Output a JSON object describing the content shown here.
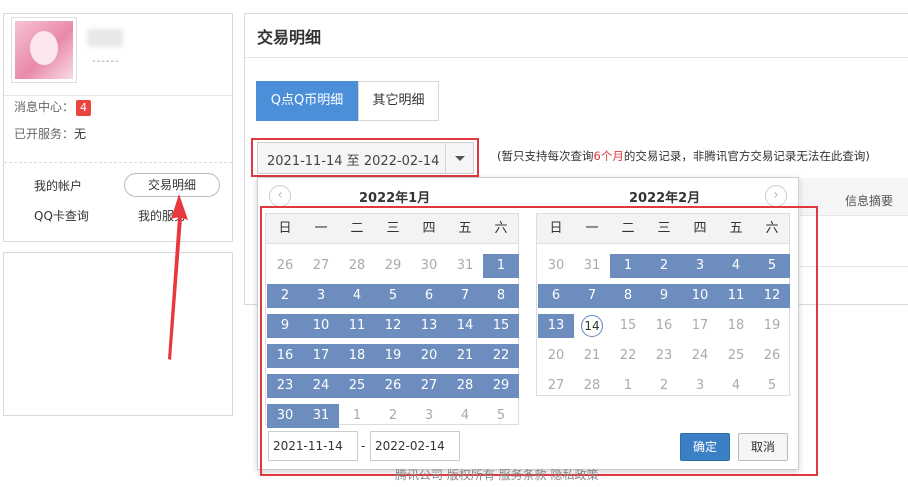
{
  "sidebar": {
    "message_center_label": "消息中心：",
    "message_count": "4",
    "services_label": "已开服务：",
    "services_value": "无",
    "username_placeholder": "------",
    "links": {
      "my_account": "我的帐户",
      "transactions": "交易明细",
      "qq_card": "QQ卡查询",
      "my_services": "我的服务"
    }
  },
  "main": {
    "title": "交易明细",
    "tabs": [
      {
        "label": "Q点Q币明细",
        "active": true
      },
      {
        "label": "其它明细",
        "active": false
      }
    ],
    "date_range": "2021-11-14 至 2022-02-14",
    "note_prefix": "(暂只支持每次查询",
    "note_highlight": "6个月",
    "note_suffix": "的交易记录，非腾讯官方交易记录无法在此查询)",
    "column_summary": "信息摘要"
  },
  "picker": {
    "prev_icon": "‹",
    "next_icon": "›",
    "weekdays": [
      "日",
      "一",
      "二",
      "三",
      "四",
      "五",
      "六"
    ],
    "months": [
      {
        "title": "2022年1月",
        "weeks": [
          [
            {
              "d": "26",
              "s": "off"
            },
            {
              "d": "27",
              "s": "off"
            },
            {
              "d": "28",
              "s": "off"
            },
            {
              "d": "29",
              "s": "off"
            },
            {
              "d": "30",
              "s": "off"
            },
            {
              "d": "31",
              "s": "off"
            },
            {
              "d": "1",
              "s": "sel"
            }
          ],
          [
            {
              "d": "2",
              "s": "sel"
            },
            {
              "d": "3",
              "s": "sel"
            },
            {
              "d": "4",
              "s": "sel"
            },
            {
              "d": "5",
              "s": "sel"
            },
            {
              "d": "6",
              "s": "sel"
            },
            {
              "d": "7",
              "s": "sel"
            },
            {
              "d": "8",
              "s": "sel"
            }
          ],
          [
            {
              "d": "9",
              "s": "sel"
            },
            {
              "d": "10",
              "s": "sel"
            },
            {
              "d": "11",
              "s": "sel"
            },
            {
              "d": "12",
              "s": "sel"
            },
            {
              "d": "13",
              "s": "sel"
            },
            {
              "d": "14",
              "s": "sel"
            },
            {
              "d": "15",
              "s": "sel"
            }
          ],
          [
            {
              "d": "16",
              "s": "sel"
            },
            {
              "d": "17",
              "s": "sel"
            },
            {
              "d": "18",
              "s": "sel"
            },
            {
              "d": "19",
              "s": "sel"
            },
            {
              "d": "20",
              "s": "sel"
            },
            {
              "d": "21",
              "s": "sel"
            },
            {
              "d": "22",
              "s": "sel"
            }
          ],
          [
            {
              "d": "23",
              "s": "sel"
            },
            {
              "d": "24",
              "s": "sel"
            },
            {
              "d": "25",
              "s": "sel"
            },
            {
              "d": "26",
              "s": "sel"
            },
            {
              "d": "27",
              "s": "sel"
            },
            {
              "d": "28",
              "s": "sel"
            },
            {
              "d": "29",
              "s": "sel"
            }
          ],
          [
            {
              "d": "30",
              "s": "sel"
            },
            {
              "d": "31",
              "s": "sel"
            },
            {
              "d": "1",
              "s": "off"
            },
            {
              "d": "2",
              "s": "off"
            },
            {
              "d": "3",
              "s": "off"
            },
            {
              "d": "4",
              "s": "off"
            },
            {
              "d": "5",
              "s": "off"
            }
          ]
        ]
      },
      {
        "title": "2022年2月",
        "weeks": [
          [
            {
              "d": "30",
              "s": "off"
            },
            {
              "d": "31",
              "s": "off"
            },
            {
              "d": "1",
              "s": "sel"
            },
            {
              "d": "2",
              "s": "sel"
            },
            {
              "d": "3",
              "s": "sel"
            },
            {
              "d": "4",
              "s": "sel"
            },
            {
              "d": "5",
              "s": "sel"
            }
          ],
          [
            {
              "d": "6",
              "s": "sel"
            },
            {
              "d": "7",
              "s": "sel"
            },
            {
              "d": "8",
              "s": "sel"
            },
            {
              "d": "9",
              "s": "sel"
            },
            {
              "d": "10",
              "s": "sel"
            },
            {
              "d": "11",
              "s": "sel"
            },
            {
              "d": "12",
              "s": "sel"
            }
          ],
          [
            {
              "d": "13",
              "s": "sel"
            },
            {
              "d": "14",
              "s": "today"
            },
            {
              "d": "15",
              "s": "off"
            },
            {
              "d": "16",
              "s": "off"
            },
            {
              "d": "17",
              "s": "off"
            },
            {
              "d": "18",
              "s": "off"
            },
            {
              "d": "19",
              "s": "off"
            }
          ],
          [
            {
              "d": "20",
              "s": "off"
            },
            {
              "d": "21",
              "s": "off"
            },
            {
              "d": "22",
              "s": "off"
            },
            {
              "d": "23",
              "s": "off"
            },
            {
              "d": "24",
              "s": "off"
            },
            {
              "d": "25",
              "s": "off"
            },
            {
              "d": "26",
              "s": "off"
            }
          ],
          [
            {
              "d": "27",
              "s": "off"
            },
            {
              "d": "28",
              "s": "off"
            },
            {
              "d": "1",
              "s": "off"
            },
            {
              "d": "2",
              "s": "off"
            },
            {
              "d": "3",
              "s": "off"
            },
            {
              "d": "4",
              "s": "off"
            },
            {
              "d": "5",
              "s": "off"
            }
          ]
        ]
      }
    ],
    "start_date": "2021-11-14",
    "end_date": "2022-02-14",
    "range_dash": "-",
    "confirm_label": "确定",
    "cancel_label": "取消"
  },
  "footer": "腾讯公司 版权所有 服务条款 隐私政策",
  "colors": {
    "accent": "#4a8fd8",
    "selected_day": "#6c8dbd",
    "highlight_red": "#e0383e"
  }
}
